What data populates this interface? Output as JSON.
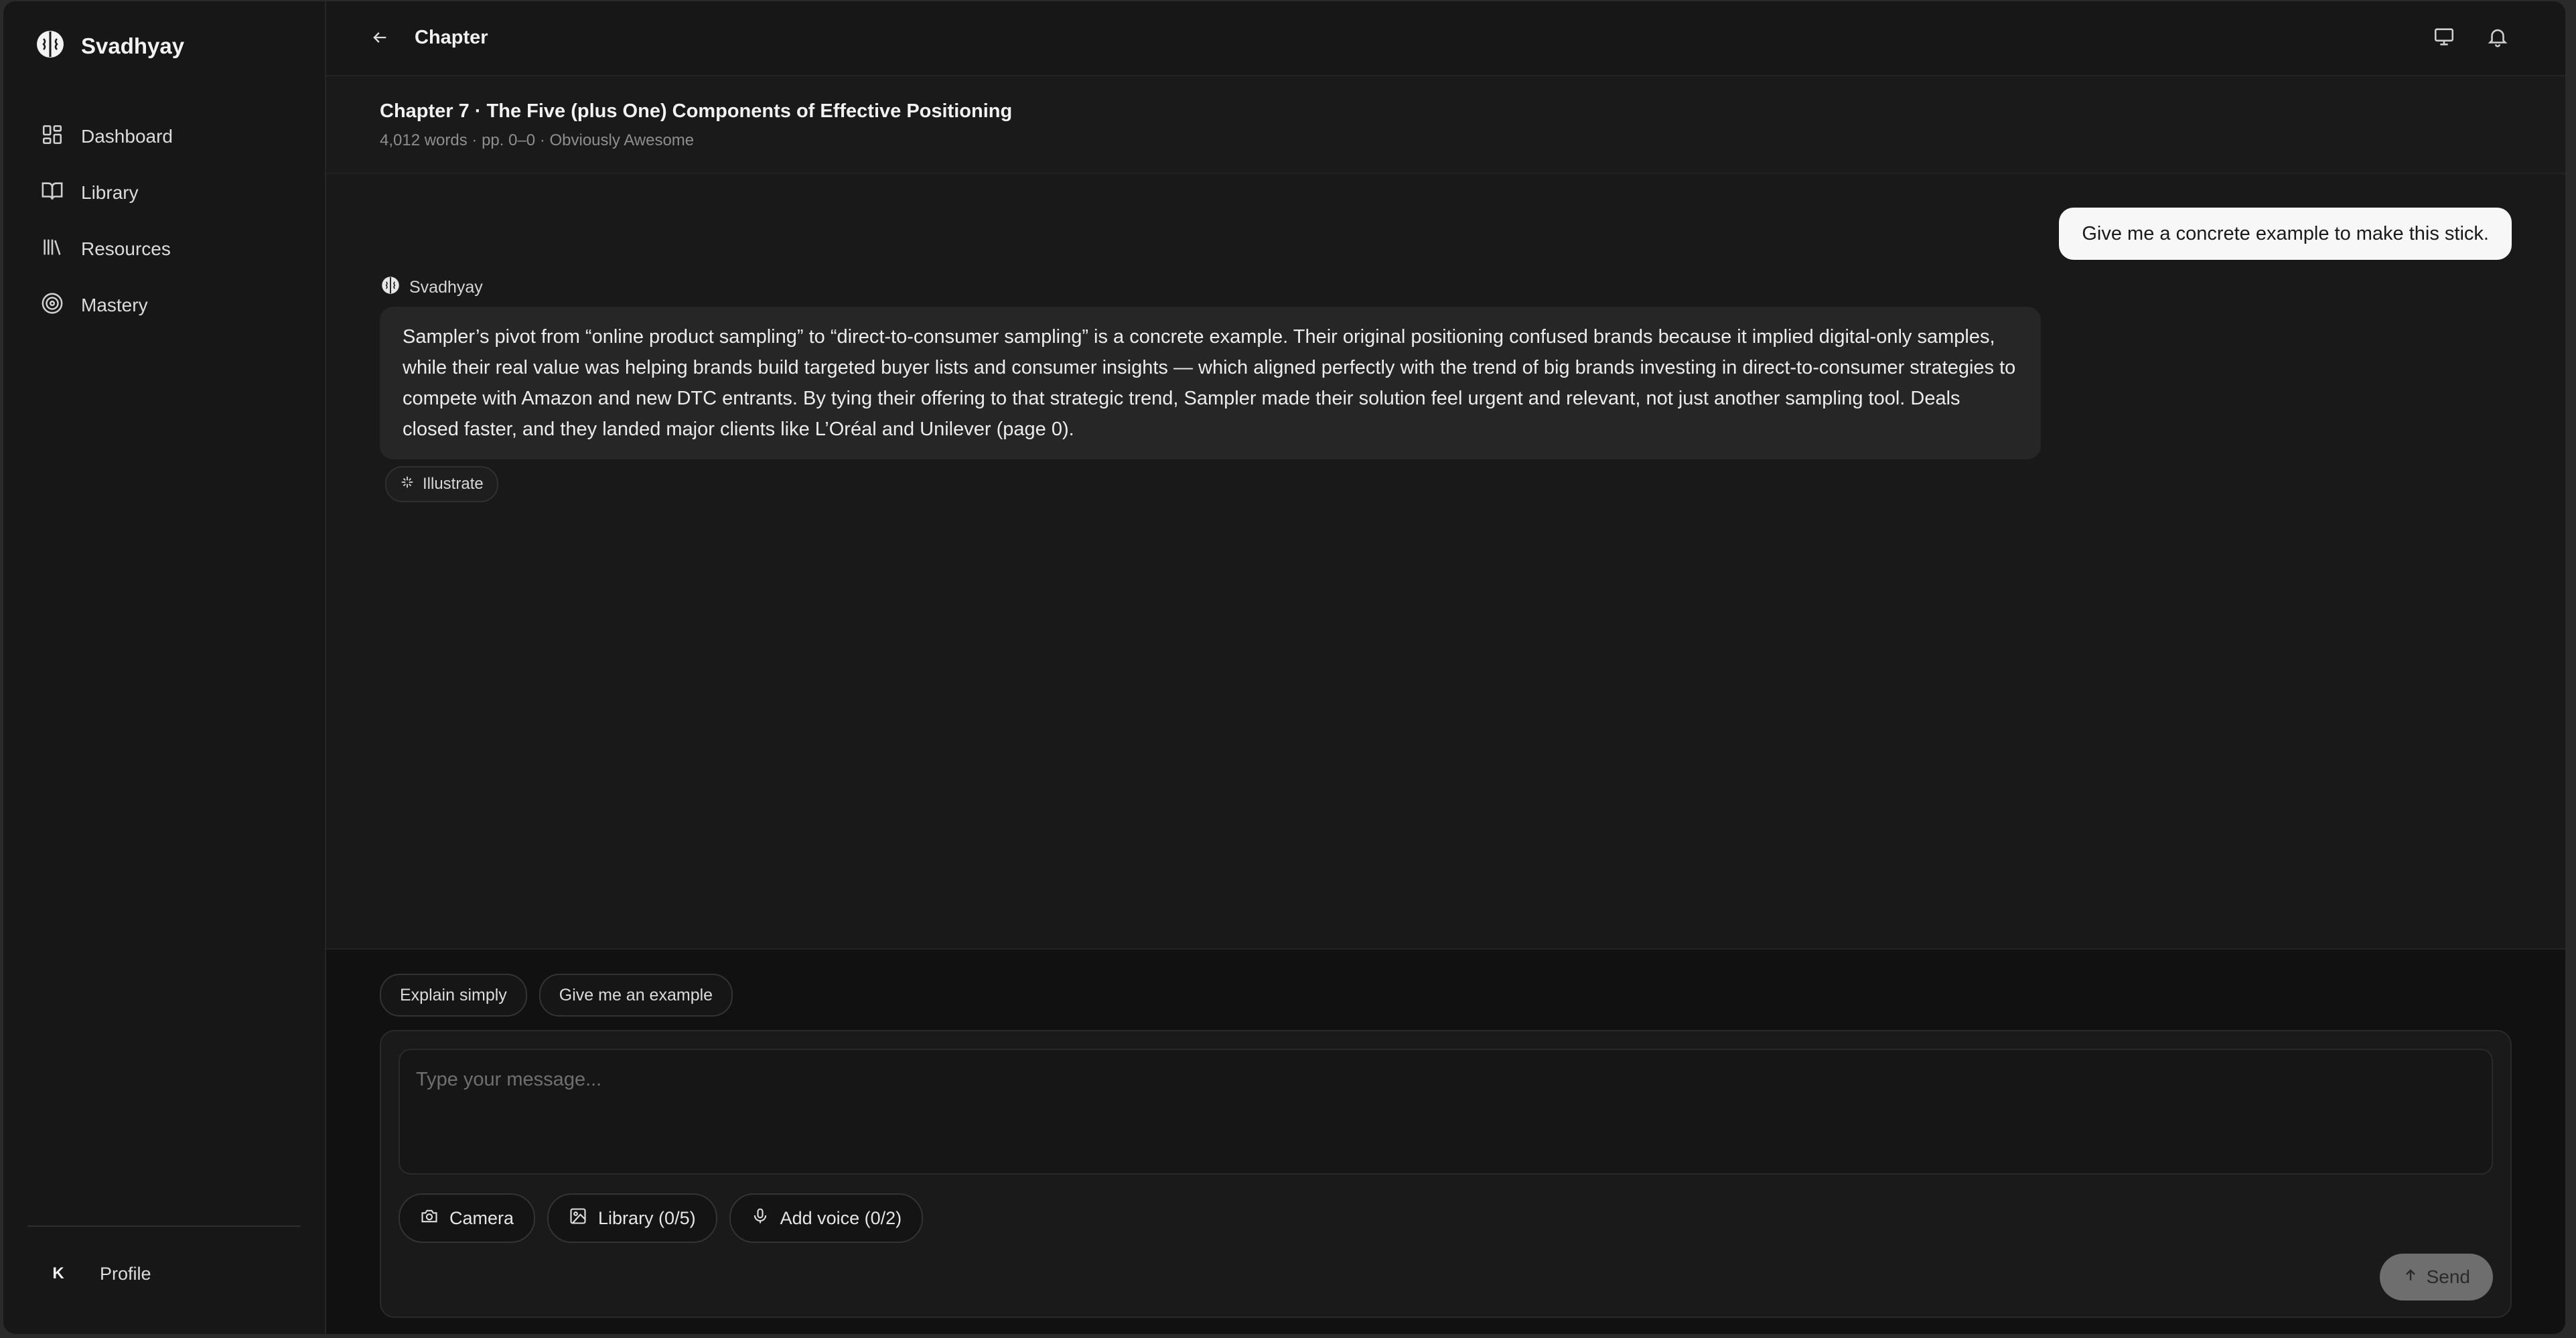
{
  "app": {
    "name": "Svadhyay"
  },
  "sidebar": {
    "items": [
      {
        "label": "Dashboard",
        "icon": "dashboard-icon"
      },
      {
        "label": "Library",
        "icon": "book-icon"
      },
      {
        "label": "Resources",
        "icon": "resources-icon"
      },
      {
        "label": "Mastery",
        "icon": "target-icon"
      }
    ],
    "profile": {
      "initial": "K",
      "label": "Profile"
    }
  },
  "topbar": {
    "title": "Chapter",
    "icons": [
      "back-arrow-icon",
      "monitor-icon",
      "bell-icon"
    ]
  },
  "chapter": {
    "title": "Chapter 7 · The Five (plus One) Components of Effective Positioning",
    "meta": "4,012 words · pp. 0–0 · Obviously Awesome"
  },
  "conversation": {
    "user_message": "Give me a concrete example to make this stick.",
    "assistant_name": "Svadhyay",
    "assistant_message": "Sampler’s pivot from “online product sampling” to “direct-to-consumer sampling” is a concrete example. Their original positioning confused brands because it implied digital-only samples, while their real value was helping brands build targeted buyer lists and consumer insights — which aligned perfectly with the trend of big brands investing in direct-to-consumer strategies to compete with Amazon and new DTC entrants. By tying their offering to that strategic trend, Sampler made their solution feel urgent and relevant, not just another sampling tool. Deals closed faster, and they landed major clients like L’Oréal and Unilever (page 0).",
    "illustrate_label": "Illustrate"
  },
  "composer": {
    "suggestions": [
      "Explain simply",
      "Give me an example"
    ],
    "placeholder": "Type your message...",
    "attachments": [
      {
        "label": "Camera",
        "icon": "camera-icon"
      },
      {
        "label": "Library (0/5)",
        "icon": "image-icon"
      },
      {
        "label": "Add voice (0/2)",
        "icon": "mic-icon"
      }
    ],
    "send_label": "Send"
  }
}
